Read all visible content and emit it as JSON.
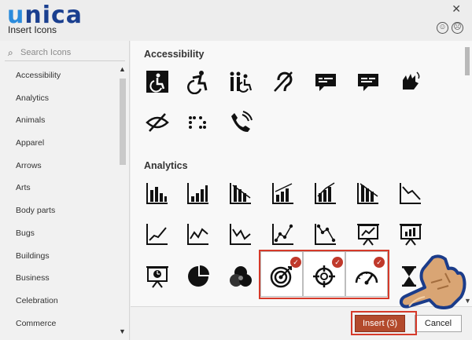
{
  "brand": {
    "first": "u",
    "rest": "nica"
  },
  "dialog": {
    "title": "Insert Icons",
    "close": "✕"
  },
  "feedback": {
    "happy": "☺",
    "sad": "☹"
  },
  "search": {
    "icon": "search-icon",
    "placeholder": "Search Icons"
  },
  "categories": [
    "Accessibility",
    "Analytics",
    "Animals",
    "Apparel",
    "Arrows",
    "Arts",
    "Body parts",
    "Bugs",
    "Buildings",
    "Business",
    "Celebration",
    "Commerce"
  ],
  "sections": {
    "accessibility": "Accessibility",
    "analytics": "Analytics"
  },
  "accessibility_icons": [
    "wheelchair-square-icon",
    "wheelchair-active-icon",
    "family-wheelchair-icon",
    "hearing-impaired-icon",
    "closed-caption-speech-icon",
    "speech-bubble-icon",
    "sign-language-icon",
    "low-vision-icon",
    "braille-icon",
    "phone-volume-icon"
  ],
  "analytics_icons": [
    "bar-chart-icon",
    "bar-chart-rising-icon",
    "bar-chart-declining-icon",
    "bar-chart-trend-up-icon",
    "bar-chart-trend-mixed-icon",
    "bar-chart-trend-down-icon",
    "line-chart-down-icon",
    "line-chart-up-icon",
    "line-chart-zigzag-icon",
    "line-chart-wave-icon",
    "scatter-up-icon",
    "scatter-down-icon",
    "presentation-chart-icon",
    "presentation-bar-icon",
    "presentation-clock-icon",
    "pie-chart-icon",
    "venn-diagram-icon",
    "target-icon",
    "crosshair-icon",
    "speedometer-icon",
    "hourglass-icon"
  ],
  "selected_count": 3,
  "buttons": {
    "insert": "Insert (3)",
    "cancel": "Cancel"
  },
  "colors": {
    "accent": "#b34a2c",
    "highlight": "#d63a2a",
    "brand_light": "#2a8bdc",
    "brand_dark": "#1a3f8f"
  }
}
